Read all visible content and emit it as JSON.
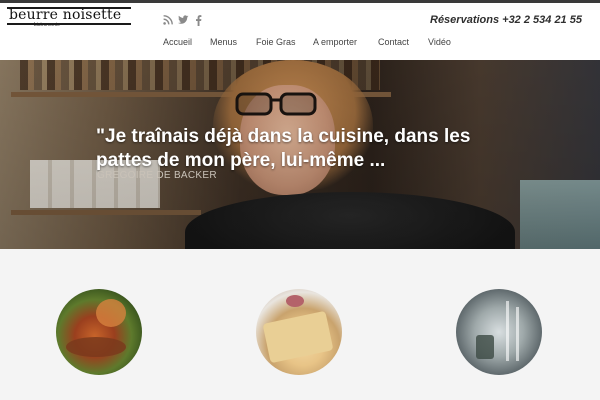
{
  "brand": {
    "name": "beurre noisette",
    "tagline": "bistronomie"
  },
  "social": {
    "icons": [
      "rss-icon",
      "twitter-icon",
      "facebook-icon"
    ]
  },
  "reservations": {
    "text": "Réservations +32 2 534 21 55"
  },
  "nav": {
    "items": [
      {
        "label": "Accueil"
      },
      {
        "label": "Menus"
      },
      {
        "label": "Foie Gras"
      },
      {
        "label": "A emporter"
      },
      {
        "label": "Contact"
      },
      {
        "label": "Vidéo"
      }
    ]
  },
  "hero": {
    "quote": "\"Je traînais déjà dans la cuisine, dans les pattes de mon père, lui-même ...",
    "author": "GREGOIRE DE BACKER"
  },
  "features": [
    {
      "image": "dish-photo"
    },
    {
      "image": "foie-gras-photo"
    },
    {
      "image": "restaurant-glasses-photo"
    }
  ],
  "colors": {
    "topbar": "#3a3a3a",
    "header_bg": "#ffffff",
    "page_bg": "#f4f4f4",
    "nav_text": "#444444",
    "quote_text": "#ffffff",
    "author_text": "#c9c2b8",
    "social_icon": "#8a8a8a"
  }
}
